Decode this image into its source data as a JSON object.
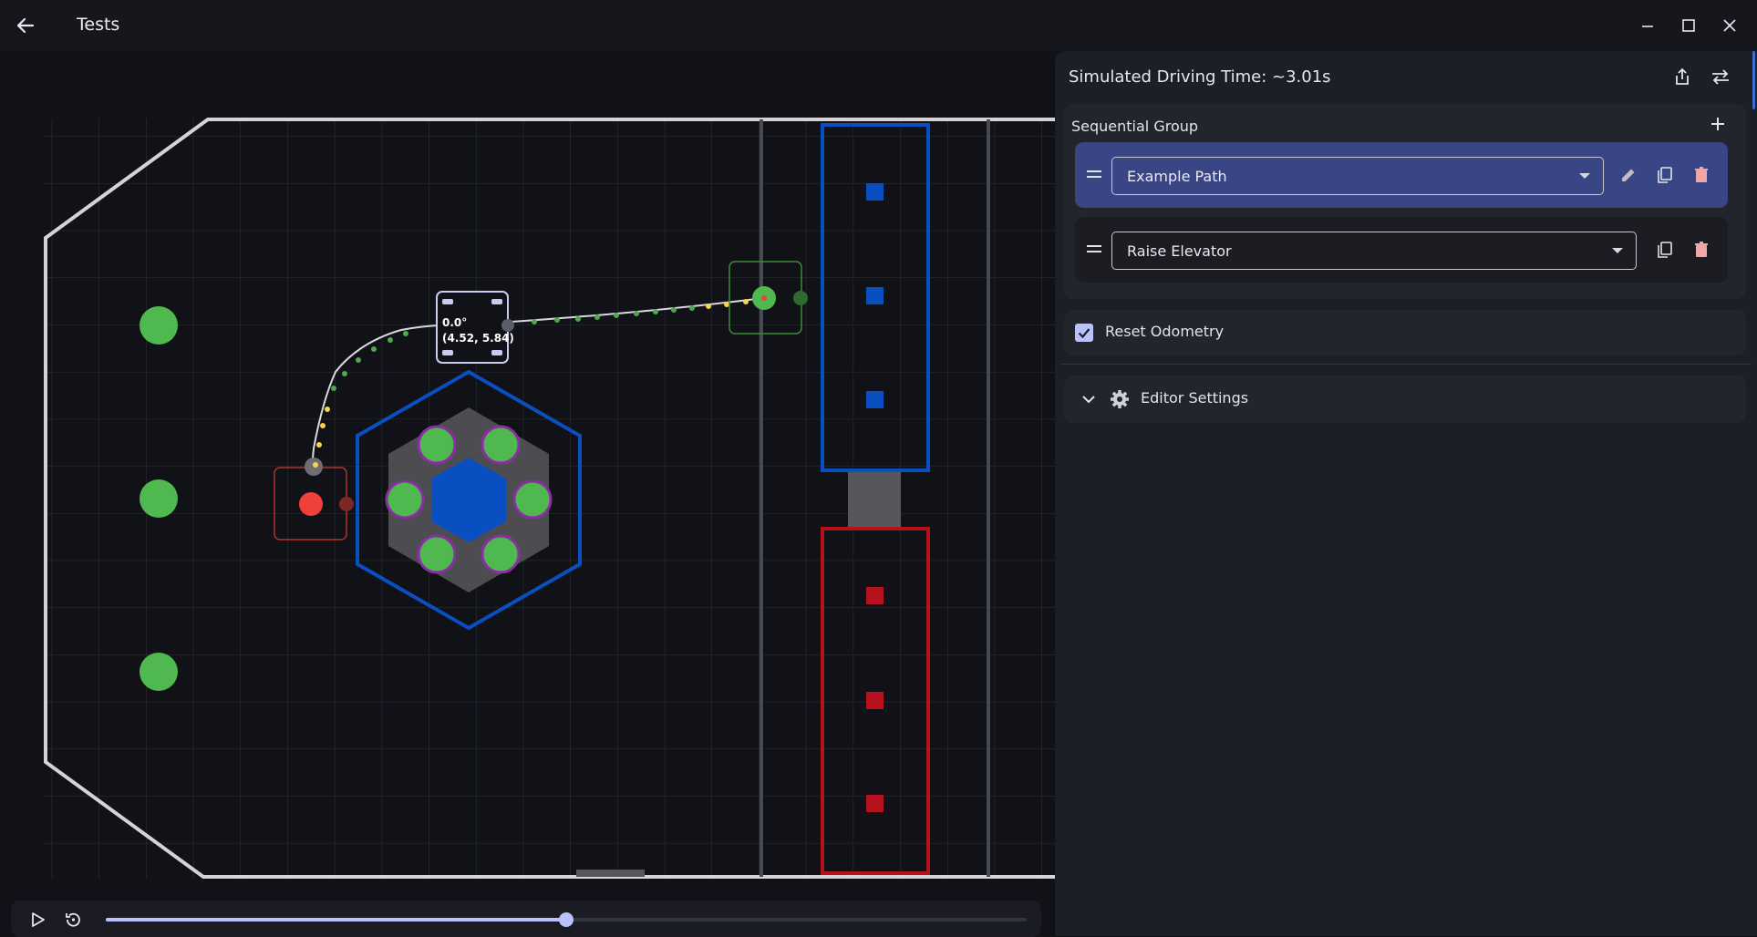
{
  "window": {
    "title": "Tests",
    "back_icon": "arrow-left-icon",
    "controls": [
      "minimize-icon",
      "maximize-icon",
      "close-icon"
    ]
  },
  "field": {
    "selected_point": {
      "rotation": "0.0°",
      "position": "(4.52, 5.84)"
    },
    "colors": {
      "alliance_blue": "#0a4fc2",
      "alliance_red": "#b5121b",
      "path_line": "#d9d9dd",
      "waypoint_yellow": "#f7d44a",
      "algae_green": "#4fb84f",
      "start_red": "#f0403a"
    }
  },
  "playback": {
    "play_icon": "play-icon",
    "replay_icon": "replay-icon",
    "progress": 0.5
  },
  "panel": {
    "simulated_time": "Simulated Driving Time: ~3.01s",
    "share_icon": "share-icon",
    "swap_icon": "swap-icon",
    "group": {
      "label": "Sequential Group",
      "add_icon": "plus-icon",
      "commands": [
        {
          "value": "Example Path",
          "selected": true
        },
        {
          "value": "Raise Elevator",
          "selected": false
        }
      ]
    },
    "reset_odometry": {
      "label": "Reset Odometry",
      "checked": true
    },
    "editor_settings": {
      "label": "Editor Settings",
      "icon": "gear-icon",
      "chevron": "chevron-down-icon"
    },
    "accent": "#b9c2fb",
    "selected_row_color": "#3a4585",
    "delete_color": "#f2a7a7"
  }
}
